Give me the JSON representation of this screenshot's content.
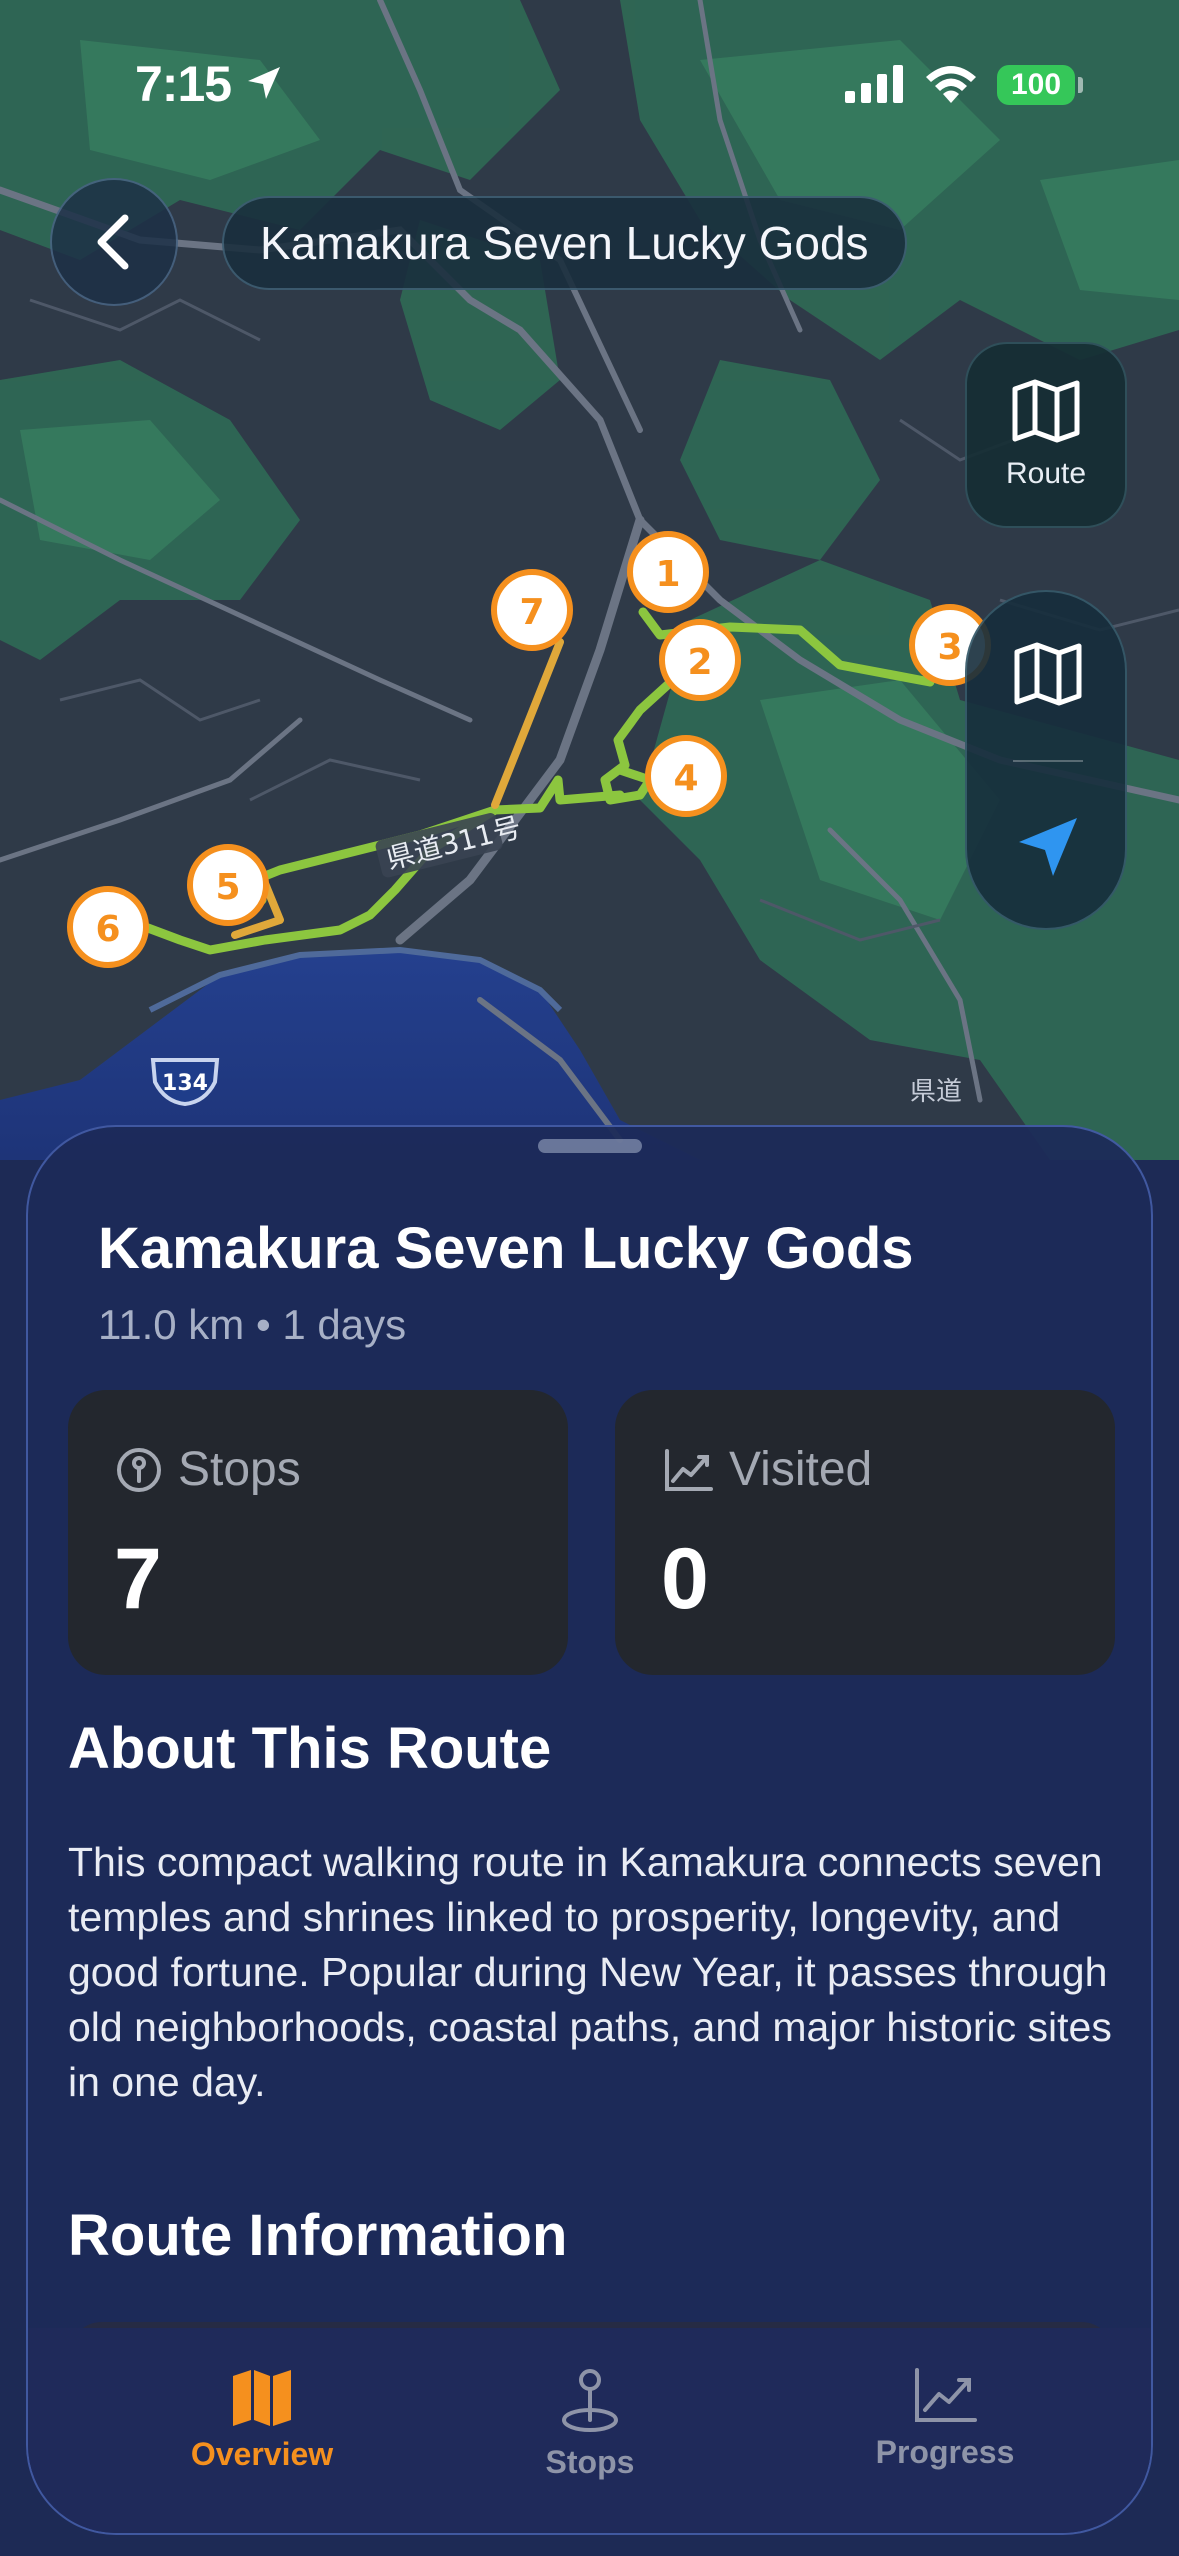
{
  "status_bar": {
    "time": "7:15",
    "battery": "100"
  },
  "header": {
    "title": "Kamakura Seven Lucky Gods"
  },
  "map": {
    "route_button_label": "Route",
    "road_label": "県道311号",
    "highway_number": "134",
    "side_label_1": "県道",
    "stops": [
      "1",
      "2",
      "3",
      "4",
      "5",
      "6",
      "7"
    ]
  },
  "sheet": {
    "title": "Kamakura Seven Lucky Gods",
    "subtitle": "11.0 km • 1 days",
    "stats": {
      "stops_label": "Stops",
      "stops_value": "7",
      "visited_label": "Visited",
      "visited_value": "0"
    },
    "about_title": "About This Route",
    "about_text": "This compact walking route in Kamakura connects seven temples and shrines linked to prosperity, longevity, and good fortune. Popular during New Year, it passes through old neighborhoods, coastal paths, and major historic sites in one day.",
    "route_info_title": "Route Information"
  },
  "tabs": [
    {
      "label": "Overview",
      "active": true
    },
    {
      "label": "Stops",
      "active": false
    },
    {
      "label": "Progress",
      "active": false
    }
  ],
  "colors": {
    "accent": "#f5901e",
    "route_green": "#8cc63f",
    "route_yellow": "#e0a83a",
    "sheet_bg": "#1c2a58",
    "card_bg": "#23272e"
  }
}
